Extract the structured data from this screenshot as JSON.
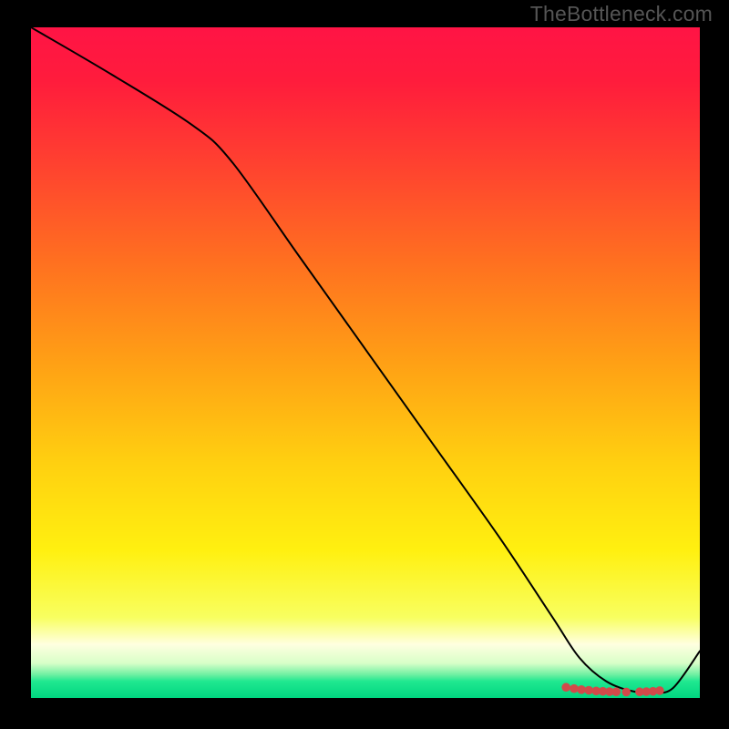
{
  "attribution": "TheBottleneck.com",
  "chart_data": {
    "type": "line",
    "title": "",
    "xlabel": "",
    "ylabel": "",
    "xlim": [
      0,
      100
    ],
    "ylim": [
      0,
      100
    ],
    "background_gradient": {
      "stops": [
        {
          "offset": 0.0,
          "color": "#ff1445"
        },
        {
          "offset": 0.08,
          "color": "#ff1c3c"
        },
        {
          "offset": 0.2,
          "color": "#ff4030"
        },
        {
          "offset": 0.35,
          "color": "#ff7020"
        },
        {
          "offset": 0.5,
          "color": "#ffa015"
        },
        {
          "offset": 0.65,
          "color": "#ffd010"
        },
        {
          "offset": 0.78,
          "color": "#fff010"
        },
        {
          "offset": 0.88,
          "color": "#f8ff60"
        },
        {
          "offset": 0.92,
          "color": "#ffffe0"
        },
        {
          "offset": 0.948,
          "color": "#d8ffc8"
        },
        {
          "offset": 0.965,
          "color": "#70f0a2"
        },
        {
          "offset": 0.975,
          "color": "#20e890"
        },
        {
          "offset": 1.0,
          "color": "#00d680"
        }
      ]
    },
    "series": [
      {
        "name": "curve",
        "color": "#000000",
        "width": 2,
        "x": [
          0.0,
          12.0,
          24.0,
          30.0,
          40.0,
          50.0,
          60.0,
          70.0,
          78.0,
          82.0,
          86.0,
          90.0,
          93.0,
          96.0,
          100.0
        ],
        "y": [
          100.0,
          93.0,
          85.5,
          80.0,
          66.0,
          52.0,
          38.0,
          24.0,
          12.0,
          6.0,
          2.5,
          1.0,
          0.8,
          1.5,
          7.0
        ]
      }
    ],
    "markers": {
      "name": "highlight-dots",
      "color": "#d24a4a",
      "radius": 4.8,
      "points": [
        {
          "x": 80.0,
          "y": 1.6
        },
        {
          "x": 81.2,
          "y": 1.4
        },
        {
          "x": 82.3,
          "y": 1.25
        },
        {
          "x": 83.4,
          "y": 1.15
        },
        {
          "x": 84.5,
          "y": 1.05
        },
        {
          "x": 85.5,
          "y": 1.0
        },
        {
          "x": 86.5,
          "y": 0.95
        },
        {
          "x": 87.5,
          "y": 0.92
        },
        {
          "x": 89.0,
          "y": 0.9
        },
        {
          "x": 91.0,
          "y": 0.92
        },
        {
          "x": 92.0,
          "y": 0.95
        },
        {
          "x": 93.0,
          "y": 1.0
        },
        {
          "x": 94.0,
          "y": 1.1
        }
      ]
    }
  }
}
